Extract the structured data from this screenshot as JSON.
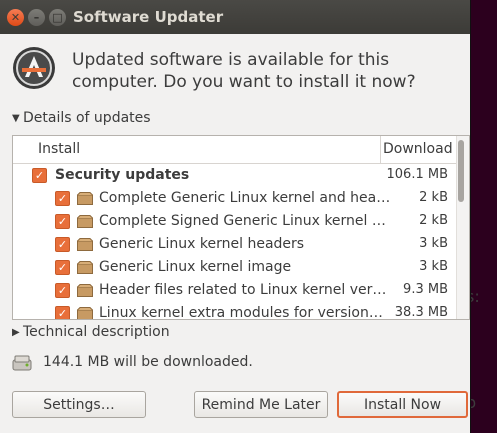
{
  "window": {
    "title": "Software Updater"
  },
  "header": {
    "message": "Updated software is available for this computer. Do you want to install it now?"
  },
  "details_expander": {
    "label": "Details of updates",
    "expanded": true
  },
  "updates_table": {
    "columns": [
      "Install",
      "Download"
    ],
    "group": {
      "label": "Security updates",
      "size": "106.1 MB",
      "checked": true
    },
    "items": [
      {
        "name": "Complete Generic Linux kernel and hea…",
        "size": "2 kB",
        "checked": true
      },
      {
        "name": "Complete Signed Generic Linux kernel …",
        "size": "2 kB",
        "checked": true
      },
      {
        "name": "Generic Linux kernel headers",
        "size": "3 kB",
        "checked": true
      },
      {
        "name": "Generic Linux kernel image",
        "size": "3 kB",
        "checked": true
      },
      {
        "name": "Header files related to Linux kernel ver…",
        "size": "9.3 MB",
        "checked": true
      },
      {
        "name": "Linux kernel extra modules for version…",
        "size": "38.3 MB",
        "checked": true
      }
    ]
  },
  "technical_expander": {
    "label": "Technical description",
    "expanded": false
  },
  "download_summary": {
    "text": "144.1 MB will be downloaded."
  },
  "buttons": {
    "settings": "Settings…",
    "remind": "Remind Me Later",
    "install": "Install Now"
  },
  "background_terminal": {
    "glyph1": "s:",
    "glyph2": "b"
  },
  "colors": {
    "accent": "#e86f3a",
    "titlebar": "#3c3b37",
    "window_bg": "#f2f1f0"
  },
  "icons": [
    "close-icon",
    "minimize-icon",
    "maximize-icon",
    "software-updater-icon",
    "package-icon",
    "disk-icon"
  ]
}
